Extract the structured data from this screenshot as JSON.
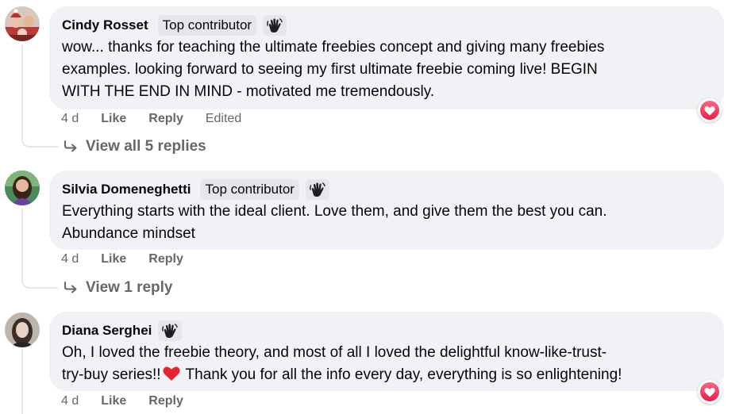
{
  "comments": [
    {
      "author": "Cindy Rosset",
      "badge": "Top contributor",
      "badge_icon": "wave-hand-icon",
      "lines": [
        "wow... thanks for teaching the ultimate freebies concept and giving many freebies",
        "examples. looking forward to seeing my first ultimate freebie coming live! BEGIN",
        "WITH THE END IN MIND - motivated me tremendously."
      ],
      "time": "4 d",
      "like": "Like",
      "reply": "Reply",
      "edited": "Edited",
      "reaction": "love",
      "view_replies": "View all 5 replies"
    },
    {
      "author": "Silvia Domeneghetti",
      "badge": "Top contributor",
      "badge_icon": "wave-hand-icon",
      "lines": [
        "Everything starts with the ideal client. Love them, and give them the best you can.",
        "Abundance mindset"
      ],
      "time": "4 d",
      "like": "Like",
      "reply": "Reply",
      "view_replies": "View 1 reply"
    },
    {
      "author": "Diana Serghei",
      "badge_icon": "wave-hand-icon",
      "lines": [
        "Oh, I loved the freebie theory, and most of all I loved the delightful know-like-trust-"
      ],
      "line2_before": "try-buy series!!",
      "line2_emoji": "red-heart-emoji",
      "line2_after": " Thank you for all the info every day, everything is so enlightening!",
      "time": "4 d",
      "like": "Like",
      "reply": "Reply",
      "reaction": "love"
    }
  ],
  "colors": {
    "bubble": "#f0f2f5",
    "badge_bg": "#e4e6eb",
    "meta_text": "#65676b",
    "love": "#f33e58"
  }
}
